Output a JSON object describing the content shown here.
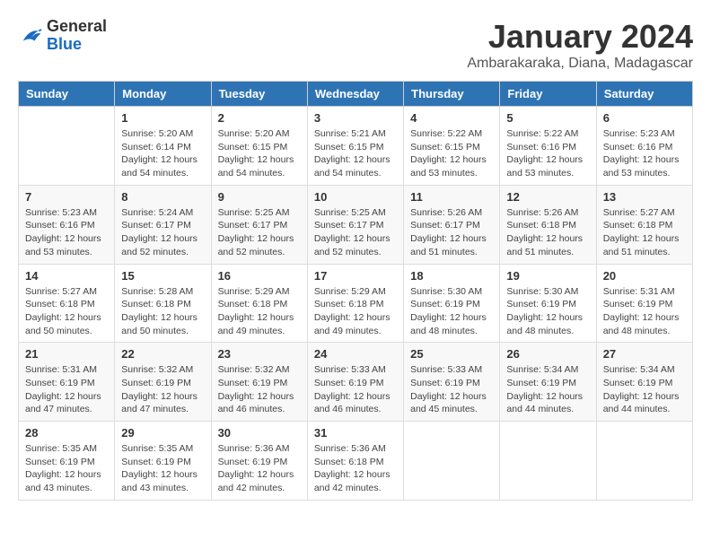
{
  "logo": {
    "general": "General",
    "blue": "Blue"
  },
  "header": {
    "month": "January 2024",
    "location": "Ambarakaraka, Diana, Madagascar"
  },
  "days_of_week": [
    "Sunday",
    "Monday",
    "Tuesday",
    "Wednesday",
    "Thursday",
    "Friday",
    "Saturday"
  ],
  "weeks": [
    [
      {
        "day": "",
        "sunrise": "",
        "sunset": "",
        "daylight": ""
      },
      {
        "day": "1",
        "sunrise": "Sunrise: 5:20 AM",
        "sunset": "Sunset: 6:14 PM",
        "daylight": "Daylight: 12 hours and 54 minutes."
      },
      {
        "day": "2",
        "sunrise": "Sunrise: 5:20 AM",
        "sunset": "Sunset: 6:15 PM",
        "daylight": "Daylight: 12 hours and 54 minutes."
      },
      {
        "day": "3",
        "sunrise": "Sunrise: 5:21 AM",
        "sunset": "Sunset: 6:15 PM",
        "daylight": "Daylight: 12 hours and 54 minutes."
      },
      {
        "day": "4",
        "sunrise": "Sunrise: 5:22 AM",
        "sunset": "Sunset: 6:15 PM",
        "daylight": "Daylight: 12 hours and 53 minutes."
      },
      {
        "day": "5",
        "sunrise": "Sunrise: 5:22 AM",
        "sunset": "Sunset: 6:16 PM",
        "daylight": "Daylight: 12 hours and 53 minutes."
      },
      {
        "day": "6",
        "sunrise": "Sunrise: 5:23 AM",
        "sunset": "Sunset: 6:16 PM",
        "daylight": "Daylight: 12 hours and 53 minutes."
      }
    ],
    [
      {
        "day": "7",
        "sunrise": "Sunrise: 5:23 AM",
        "sunset": "Sunset: 6:16 PM",
        "daylight": "Daylight: 12 hours and 53 minutes."
      },
      {
        "day": "8",
        "sunrise": "Sunrise: 5:24 AM",
        "sunset": "Sunset: 6:17 PM",
        "daylight": "Daylight: 12 hours and 52 minutes."
      },
      {
        "day": "9",
        "sunrise": "Sunrise: 5:25 AM",
        "sunset": "Sunset: 6:17 PM",
        "daylight": "Daylight: 12 hours and 52 minutes."
      },
      {
        "day": "10",
        "sunrise": "Sunrise: 5:25 AM",
        "sunset": "Sunset: 6:17 PM",
        "daylight": "Daylight: 12 hours and 52 minutes."
      },
      {
        "day": "11",
        "sunrise": "Sunrise: 5:26 AM",
        "sunset": "Sunset: 6:17 PM",
        "daylight": "Daylight: 12 hours and 51 minutes."
      },
      {
        "day": "12",
        "sunrise": "Sunrise: 5:26 AM",
        "sunset": "Sunset: 6:18 PM",
        "daylight": "Daylight: 12 hours and 51 minutes."
      },
      {
        "day": "13",
        "sunrise": "Sunrise: 5:27 AM",
        "sunset": "Sunset: 6:18 PM",
        "daylight": "Daylight: 12 hours and 51 minutes."
      }
    ],
    [
      {
        "day": "14",
        "sunrise": "Sunrise: 5:27 AM",
        "sunset": "Sunset: 6:18 PM",
        "daylight": "Daylight: 12 hours and 50 minutes."
      },
      {
        "day": "15",
        "sunrise": "Sunrise: 5:28 AM",
        "sunset": "Sunset: 6:18 PM",
        "daylight": "Daylight: 12 hours and 50 minutes."
      },
      {
        "day": "16",
        "sunrise": "Sunrise: 5:29 AM",
        "sunset": "Sunset: 6:18 PM",
        "daylight": "Daylight: 12 hours and 49 minutes."
      },
      {
        "day": "17",
        "sunrise": "Sunrise: 5:29 AM",
        "sunset": "Sunset: 6:18 PM",
        "daylight": "Daylight: 12 hours and 49 minutes."
      },
      {
        "day": "18",
        "sunrise": "Sunrise: 5:30 AM",
        "sunset": "Sunset: 6:19 PM",
        "daylight": "Daylight: 12 hours and 48 minutes."
      },
      {
        "day": "19",
        "sunrise": "Sunrise: 5:30 AM",
        "sunset": "Sunset: 6:19 PM",
        "daylight": "Daylight: 12 hours and 48 minutes."
      },
      {
        "day": "20",
        "sunrise": "Sunrise: 5:31 AM",
        "sunset": "Sunset: 6:19 PM",
        "daylight": "Daylight: 12 hours and 48 minutes."
      }
    ],
    [
      {
        "day": "21",
        "sunrise": "Sunrise: 5:31 AM",
        "sunset": "Sunset: 6:19 PM",
        "daylight": "Daylight: 12 hours and 47 minutes."
      },
      {
        "day": "22",
        "sunrise": "Sunrise: 5:32 AM",
        "sunset": "Sunset: 6:19 PM",
        "daylight": "Daylight: 12 hours and 47 minutes."
      },
      {
        "day": "23",
        "sunrise": "Sunrise: 5:32 AM",
        "sunset": "Sunset: 6:19 PM",
        "daylight": "Daylight: 12 hours and 46 minutes."
      },
      {
        "day": "24",
        "sunrise": "Sunrise: 5:33 AM",
        "sunset": "Sunset: 6:19 PM",
        "daylight": "Daylight: 12 hours and 46 minutes."
      },
      {
        "day": "25",
        "sunrise": "Sunrise: 5:33 AM",
        "sunset": "Sunset: 6:19 PM",
        "daylight": "Daylight: 12 hours and 45 minutes."
      },
      {
        "day": "26",
        "sunrise": "Sunrise: 5:34 AM",
        "sunset": "Sunset: 6:19 PM",
        "daylight": "Daylight: 12 hours and 44 minutes."
      },
      {
        "day": "27",
        "sunrise": "Sunrise: 5:34 AM",
        "sunset": "Sunset: 6:19 PM",
        "daylight": "Daylight: 12 hours and 44 minutes."
      }
    ],
    [
      {
        "day": "28",
        "sunrise": "Sunrise: 5:35 AM",
        "sunset": "Sunset: 6:19 PM",
        "daylight": "Daylight: 12 hours and 43 minutes."
      },
      {
        "day": "29",
        "sunrise": "Sunrise: 5:35 AM",
        "sunset": "Sunset: 6:19 PM",
        "daylight": "Daylight: 12 hours and 43 minutes."
      },
      {
        "day": "30",
        "sunrise": "Sunrise: 5:36 AM",
        "sunset": "Sunset: 6:19 PM",
        "daylight": "Daylight: 12 hours and 42 minutes."
      },
      {
        "day": "31",
        "sunrise": "Sunrise: 5:36 AM",
        "sunset": "Sunset: 6:18 PM",
        "daylight": "Daylight: 12 hours and 42 minutes."
      },
      {
        "day": "",
        "sunrise": "",
        "sunset": "",
        "daylight": ""
      },
      {
        "day": "",
        "sunrise": "",
        "sunset": "",
        "daylight": ""
      },
      {
        "day": "",
        "sunrise": "",
        "sunset": "",
        "daylight": ""
      }
    ]
  ]
}
